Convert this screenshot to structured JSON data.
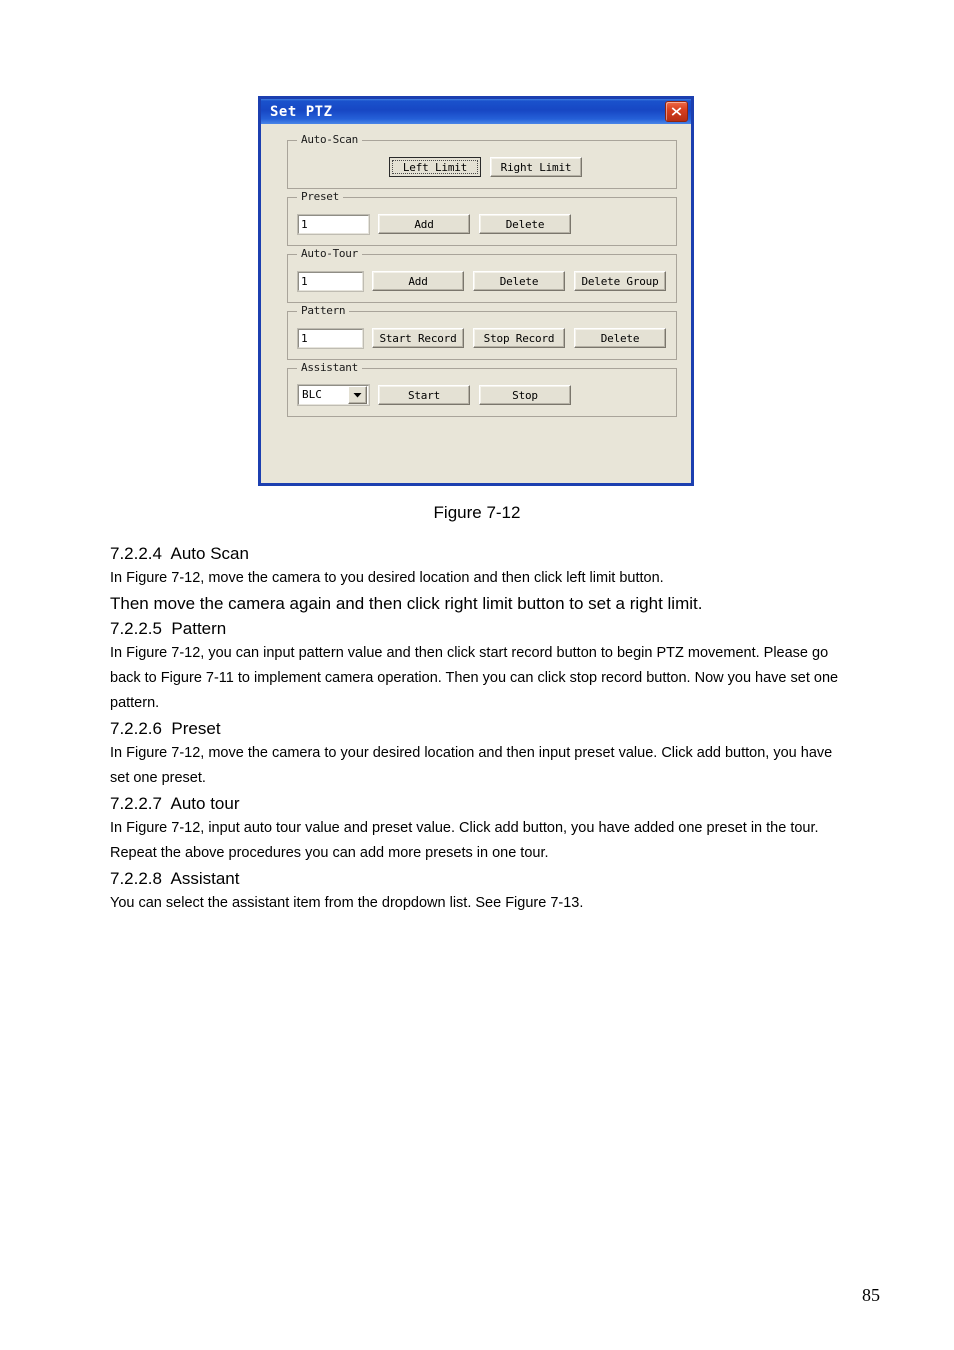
{
  "dialog": {
    "title": "Set PTZ",
    "close_icon": "close-icon",
    "groups": [
      {
        "label": "Auto-Scan",
        "buttons": [
          {
            "label": "Left Limit",
            "focused": true
          },
          {
            "label": "Right Limit",
            "focused": false
          }
        ]
      },
      {
        "label": "Preset",
        "input_value": "1",
        "buttons": [
          {
            "label": "Add",
            "focused": false
          },
          {
            "label": "Delete",
            "focused": false
          }
        ]
      },
      {
        "label": "Auto-Tour",
        "input_value": "1",
        "buttons": [
          {
            "label": "Add",
            "focused": false
          },
          {
            "label": "Delete",
            "focused": false
          },
          {
            "label": "Delete Group",
            "focused": false
          }
        ]
      },
      {
        "label": "Pattern",
        "input_value": "1",
        "buttons": [
          {
            "label": "Start Record",
            "focused": false
          },
          {
            "label": "Stop Record",
            "focused": false
          },
          {
            "label": "Delete",
            "focused": false
          }
        ]
      },
      {
        "label": "Assistant",
        "combo_value": "BLC",
        "combo_arrow_icon": "chevron-down-icon",
        "buttons": [
          {
            "label": "Start",
            "focused": false
          },
          {
            "label": "Stop",
            "focused": false
          }
        ]
      }
    ]
  },
  "figure_caption": "Figure 7-12",
  "document": {
    "sections": [
      {
        "heading": "7.2.2.4  Auto Scan",
        "paragraphs": [
          {
            "text": "In Figure 7-12, move the camera to you desired location and then click left limit button.",
            "size": "normal"
          },
          {
            "text": "Then move the camera again and then click right limit button to set a right limit.",
            "size": "big"
          }
        ]
      },
      {
        "heading": "7.2.2.5  Pattern",
        "paragraphs": [
          {
            "text": "In Figure 7-12, you can input pattern value and then click start record button to begin PTZ movement. Please go back to Figure 7-11 to implement camera operation. Then you can click stop record button. Now you have set one pattern.",
            "size": "normal"
          }
        ]
      },
      {
        "heading": "7.2.2.6  Preset",
        "paragraphs": [
          {
            "text": "In Figure 7-12, move the camera to your desired location and then input preset value. Click add button, you have set one preset.",
            "size": "normal"
          }
        ]
      },
      {
        "heading": "7.2.2.7  Auto tour",
        "paragraphs": [
          {
            "text": "In Figure 7-12, input auto tour value and preset value. Click add button, you have added one preset in the tour.",
            "size": "normal"
          },
          {
            "text": "Repeat the above procedures you can add more presets in one tour.",
            "size": "normal"
          }
        ]
      },
      {
        "heading": "7.2.2.8  Assistant",
        "paragraphs": [
          {
            "text": "You can select the assistant item from the dropdown list. See Figure 7-13.",
            "size": "normal"
          }
        ]
      }
    ]
  },
  "page_number": "85",
  "colors": {
    "title_bar": "#1747c4",
    "dialog_face": "#e8e5d8",
    "close_button": "#d8401f",
    "dialog_border": "#1c3fb0"
  }
}
